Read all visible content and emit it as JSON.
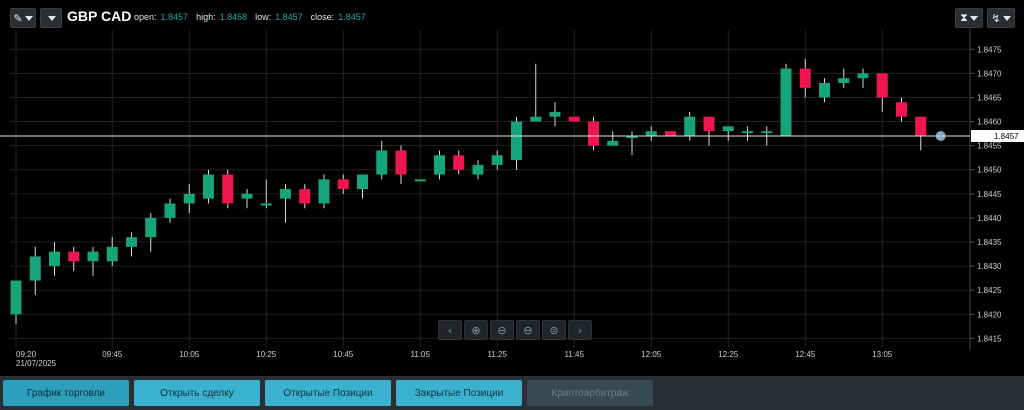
{
  "toolbar": {
    "symbol": "GBP CAD",
    "ohlc": {
      "open_label": "open:",
      "open": "1.8457",
      "high_label": "high:",
      "high": "1.8458",
      "low_label": "low:",
      "low": "1.8457",
      "close_label": "close:",
      "close": "1.8457"
    },
    "icons": {
      "tool": "pencil-icon",
      "clock": "hourglass-icon",
      "indicators": "indicator-icon"
    }
  },
  "chart_data": {
    "type": "candlestick",
    "x_ticks": [
      {
        "label": "09:20",
        "sub": "21/07/2025",
        "index": 0
      },
      {
        "label": "09:45",
        "index": 5
      },
      {
        "label": "10:05",
        "index": 9
      },
      {
        "label": "10:25",
        "index": 13
      },
      {
        "label": "10:45",
        "index": 17
      },
      {
        "label": "11:05",
        "index": 21
      },
      {
        "label": "11:25",
        "index": 25
      },
      {
        "label": "11:45",
        "index": 29
      },
      {
        "label": "12:05",
        "index": 33
      },
      {
        "label": "12:25",
        "index": 37
      },
      {
        "label": "12:45",
        "index": 41
      },
      {
        "label": "13:05",
        "index": 45
      }
    ],
    "y_ticks": [
      "1.8475",
      "1.8470",
      "1.8465",
      "1.8460",
      "1.8455",
      "1.8450",
      "1.8445",
      "1.8440",
      "1.8435",
      "1.8430",
      "1.8425",
      "1.8420",
      "1.8415"
    ],
    "ylim": [
      1.8413,
      1.8479
    ],
    "current_price": "1.8457",
    "candles": [
      [
        1.842,
        1.8427,
        1.8418,
        1.8427
      ],
      [
        1.8427,
        1.8432,
        1.8424,
        1.8434
      ],
      [
        1.843,
        1.8433,
        1.8428,
        1.8435
      ],
      [
        1.8433,
        1.8431,
        1.8429,
        1.8434
      ],
      [
        1.8431,
        1.8433,
        1.8428,
        1.8434
      ],
      [
        1.8431,
        1.8434,
        1.843,
        1.8436
      ],
      [
        1.8434,
        1.8436,
        1.8432,
        1.8437
      ],
      [
        1.8436,
        1.844,
        1.8433,
        1.8441
      ],
      [
        1.844,
        1.8443,
        1.8439,
        1.8444
      ],
      [
        1.8443,
        1.8445,
        1.8441,
        1.8447
      ],
      [
        1.8444,
        1.8449,
        1.8443,
        1.845
      ],
      [
        1.8449,
        1.8443,
        1.8442,
        1.845
      ],
      [
        1.8444,
        1.8445,
        1.8442,
        1.8446
      ],
      [
        1.8443,
        1.8443,
        1.8442,
        1.8448
      ],
      [
        1.8444,
        1.8446,
        1.8439,
        1.8447
      ],
      [
        1.8446,
        1.8443,
        1.8442,
        1.8447
      ],
      [
        1.8443,
        1.8448,
        1.8442,
        1.8449
      ],
      [
        1.8448,
        1.8446,
        1.8445,
        1.8449
      ],
      [
        1.8446,
        1.8449,
        1.8444,
        1.8449
      ],
      [
        1.8449,
        1.8454,
        1.8448,
        1.8456
      ],
      [
        1.8454,
        1.8449,
        1.8447,
        1.8455
      ],
      [
        1.8448,
        1.8448,
        1.8448,
        1.8448
      ],
      [
        1.8449,
        1.8453,
        1.8448,
        1.8454
      ],
      [
        1.8453,
        1.845,
        1.8449,
        1.8454
      ],
      [
        1.8449,
        1.8451,
        1.8448,
        1.8452
      ],
      [
        1.8451,
        1.8453,
        1.845,
        1.8454
      ],
      [
        1.8452,
        1.846,
        1.845,
        1.8461
      ],
      [
        1.846,
        1.8461,
        1.846,
        1.8472
      ],
      [
        1.8461,
        1.8462,
        1.8459,
        1.8464
      ],
      [
        1.8461,
        1.846,
        1.846,
        1.8461
      ],
      [
        1.846,
        1.8455,
        1.8454,
        1.8461
      ],
      [
        1.8455,
        1.8456,
        1.8455,
        1.8458
      ],
      [
        1.8457,
        1.8457,
        1.8453,
        1.8458
      ],
      [
        1.8457,
        1.8458,
        1.8456,
        1.8459
      ],
      [
        1.8458,
        1.8457,
        1.8457,
        1.8458
      ],
      [
        1.8457,
        1.8461,
        1.8456,
        1.8462
      ],
      [
        1.8461,
        1.8458,
        1.8455,
        1.8461
      ],
      [
        1.8458,
        1.8459,
        1.8456,
        1.8459
      ],
      [
        1.8458,
        1.8458,
        1.8456,
        1.8459
      ],
      [
        1.8458,
        1.8458,
        1.8455,
        1.8459
      ],
      [
        1.8457,
        1.8471,
        1.8457,
        1.8472
      ],
      [
        1.8471,
        1.8467,
        1.8465,
        1.8473
      ],
      [
        1.8465,
        1.8468,
        1.8464,
        1.8469
      ],
      [
        1.8468,
        1.8469,
        1.8467,
        1.8471
      ],
      [
        1.8469,
        1.847,
        1.8467,
        1.8471
      ],
      [
        1.847,
        1.8465,
        1.8462,
        1.847
      ],
      [
        1.8464,
        1.8461,
        1.846,
        1.8465
      ],
      [
        1.8461,
        1.8457,
        1.8454,
        1.8461
      ]
    ]
  },
  "zoom_controls": {
    "icons": [
      "chevron-left-icon",
      "zoom-in-icon",
      "zoom-out-icon",
      "zoom-minus-icon",
      "zoom-reset-icon",
      "chevron-right-icon"
    ]
  },
  "bottom_bar": {
    "buttons": [
      {
        "label": "График торговли",
        "state": "selected"
      },
      {
        "label": "Открыть сделку",
        "state": "active"
      },
      {
        "label": "Открытые Позиции",
        "state": "active"
      },
      {
        "label": "Закрытые Позиции",
        "state": "active"
      },
      {
        "label": "Криптоарбитраж",
        "state": "disabled"
      }
    ]
  },
  "colors": {
    "up": "#16a57a",
    "down": "#f0144f",
    "grid": "#222222",
    "background": "#000000"
  }
}
